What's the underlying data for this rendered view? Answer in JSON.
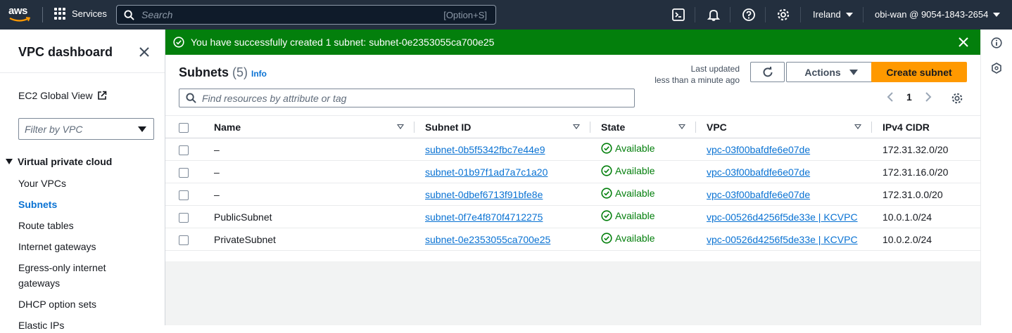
{
  "topnav": {
    "logo_text": "aws",
    "services_label": "Services",
    "search_placeholder": "Search",
    "search_shortcut": "[Option+S]",
    "region": "Ireland",
    "account": "obi-wan @ 9054-1843-2654"
  },
  "sidebar": {
    "title": "VPC dashboard",
    "ec2_global_view": "EC2 Global View",
    "filter_placeholder": "Filter by VPC",
    "section_title": "Virtual private cloud",
    "items": [
      {
        "label": "Your VPCs",
        "active": false
      },
      {
        "label": "Subnets",
        "active": true
      },
      {
        "label": "Route tables",
        "active": false
      },
      {
        "label": "Internet gateways",
        "active": false
      },
      {
        "label": "Egress-only internet",
        "active": false
      },
      {
        "label": "gateways",
        "active": false
      },
      {
        "label": "DHCP option sets",
        "active": false
      },
      {
        "label": "Elastic IPs",
        "active": false
      }
    ]
  },
  "flash": {
    "message": "You have successfully created 1 subnet: subnet-0e2353055ca700e25",
    "color": "#037f0c"
  },
  "panel": {
    "title": "Subnets",
    "count": "(5)",
    "info": "Info",
    "last_updated_line1": "Last updated",
    "last_updated_line2": "less than a minute ago",
    "actions_label": "Actions",
    "create_label": "Create subnet",
    "find_placeholder": "Find resources by attribute or tag",
    "page": "1"
  },
  "table": {
    "headers": [
      "Name",
      "Subnet ID",
      "State",
      "VPC",
      "IPv4 CIDR"
    ],
    "rows": [
      {
        "name": "–",
        "subnet_id": "subnet-0b5f5342fbc7e44e9",
        "state": "Available",
        "vpc": "vpc-03f00bafdfe6e07de",
        "cidr": "172.31.32.0/20"
      },
      {
        "name": "–",
        "subnet_id": "subnet-01b97f1ad7a7c1a20",
        "state": "Available",
        "vpc": "vpc-03f00bafdfe6e07de",
        "cidr": "172.31.16.0/20"
      },
      {
        "name": "–",
        "subnet_id": "subnet-0dbef6713f91bfe8e",
        "state": "Available",
        "vpc": "vpc-03f00bafdfe6e07de",
        "cidr": "172.31.0.0/20"
      },
      {
        "name": "PublicSubnet",
        "subnet_id": "subnet-0f7e4f870f4712275",
        "state": "Available",
        "vpc": "vpc-00526d4256f5de33e | KCVPC",
        "cidr": "10.0.1.0/24"
      },
      {
        "name": "PrivateSubnet",
        "subnet_id": "subnet-0e2353055ca700e25",
        "state": "Available",
        "vpc": "vpc-00526d4256f5de33e | KCVPC",
        "cidr": "10.0.2.0/24"
      }
    ]
  },
  "colors": {
    "nav_bg": "#232f3e",
    "link": "#0972d3",
    "primary_button": "#ff9900",
    "success": "#037f0c"
  }
}
